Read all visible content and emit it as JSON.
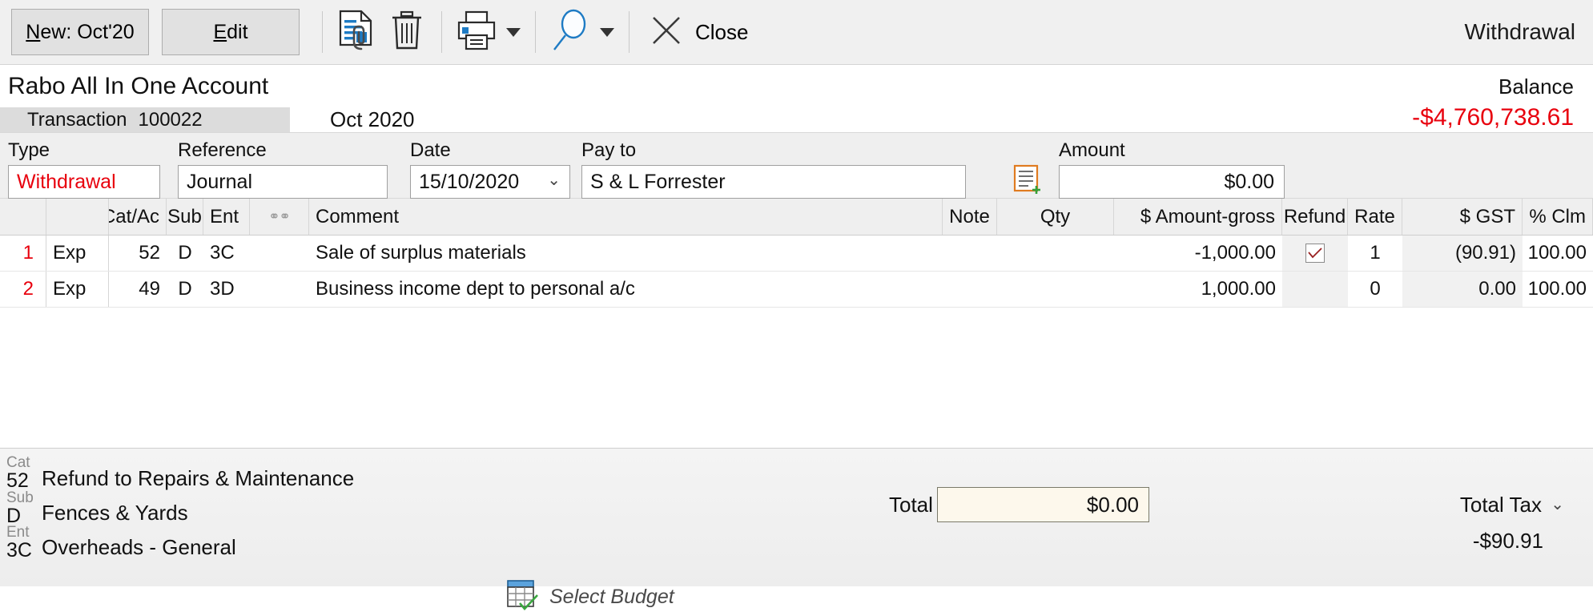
{
  "toolbar": {
    "new_button": {
      "accel": "N",
      "rest": "ew: Oct'20"
    },
    "edit_button": {
      "accel": "E",
      "rest": "dit"
    },
    "attach_icon": "document-attachment-icon",
    "delete_icon": "trash-icon",
    "print_icon": "printer-icon",
    "search_icon": "magnifier-icon",
    "close_icon": "close-x-icon",
    "close_label": "Close",
    "window_title": "Withdrawal"
  },
  "account": {
    "name": "Rabo All In One Account",
    "balance_label": "Balance",
    "balance_value": "-$4,760,738.61",
    "balance_color": "#e8000d",
    "tab_label": "Transaction",
    "tab_number": "100022",
    "period": "Oct 2020"
  },
  "form": {
    "type": {
      "label": "Type",
      "value": "Withdrawal"
    },
    "reference": {
      "label": "Reference",
      "value": "Journal"
    },
    "date": {
      "label": "Date",
      "value": "15/10/2020"
    },
    "payto": {
      "label": "Pay to",
      "value": "S & L Forrester"
    },
    "note_icon": "add-note-icon",
    "amount": {
      "label": "Amount",
      "value": "$0.00"
    }
  },
  "grid": {
    "columns": [
      "",
      "",
      "Cat/Ac",
      "Sub",
      "Ent",
      "link",
      "Comment",
      "Note",
      "Qty",
      "$ Amount-gross",
      "Refund",
      "Rate",
      "$ GST",
      "% Clm"
    ],
    "rows": [
      {
        "num": "1",
        "type": "Exp",
        "cat": "52",
        "sub": "D",
        "ent": "3C",
        "link": "",
        "comment": "Sale of surplus materials",
        "note": "",
        "qty": "",
        "amount": "-1,000.00",
        "refund": true,
        "rate": "1",
        "gst": "(90.91)",
        "clm": "100.00"
      },
      {
        "num": "2",
        "type": "Exp",
        "cat": "49",
        "sub": "D",
        "ent": "3D",
        "link": "",
        "comment": "Business income dept to personal a/c",
        "note": "",
        "qty": "",
        "amount": "1,000.00",
        "refund": false,
        "rate": "0",
        "gst": "0.00",
        "clm": "100.00"
      }
    ]
  },
  "footer": {
    "cat": {
      "tag": "Cat",
      "code": "52",
      "desc": "Refund to Repairs & Maintenance"
    },
    "sub": {
      "tag": "Sub",
      "code": "D",
      "desc": "Fences & Yards"
    },
    "ent": {
      "tag": "Ent",
      "code": "3C",
      "desc": "Overheads - General"
    },
    "budget_icon": "select-budget-icon",
    "budget_label": "Select Budget",
    "total_label": "Total",
    "total_value": "$0.00",
    "tax_label": "Total Tax",
    "tax_value": "-$90.91"
  }
}
